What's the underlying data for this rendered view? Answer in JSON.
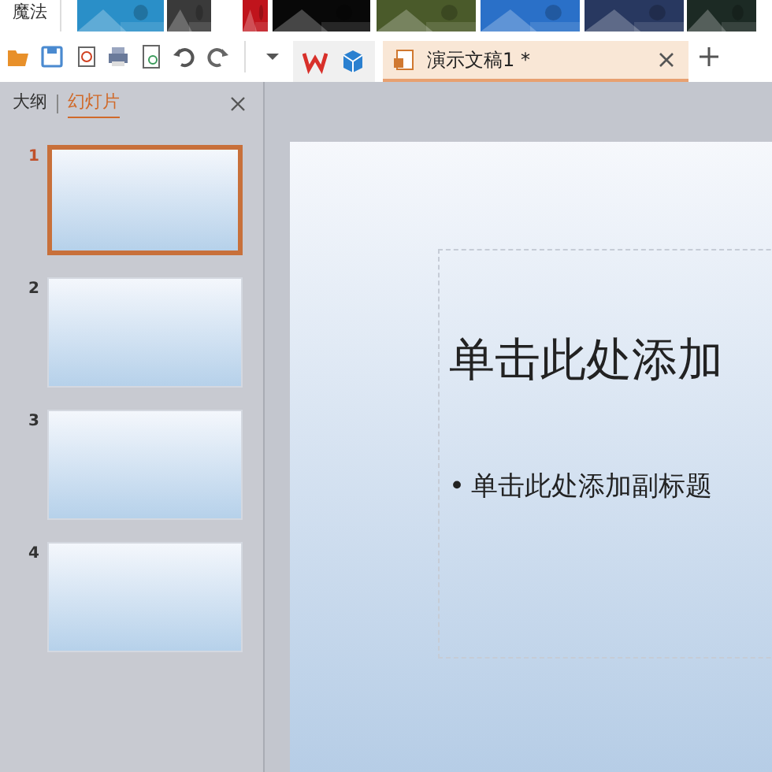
{
  "top_strip": {
    "label": "魔法"
  },
  "document_tab": {
    "title": "演示文稿1 *",
    "selected": true
  },
  "panel": {
    "tabs": [
      {
        "label": "大纲",
        "selected": false
      },
      {
        "label": "幻灯片",
        "selected": true
      }
    ]
  },
  "slides": [
    {
      "number": "1",
      "selected": true
    },
    {
      "number": "2",
      "selected": false
    },
    {
      "number": "3",
      "selected": false
    },
    {
      "number": "4",
      "selected": false
    }
  ],
  "slide": {
    "title_placeholder": "单击此处添加",
    "bullet": "•",
    "subtitle_placeholder": "单击此处添加副标题"
  }
}
